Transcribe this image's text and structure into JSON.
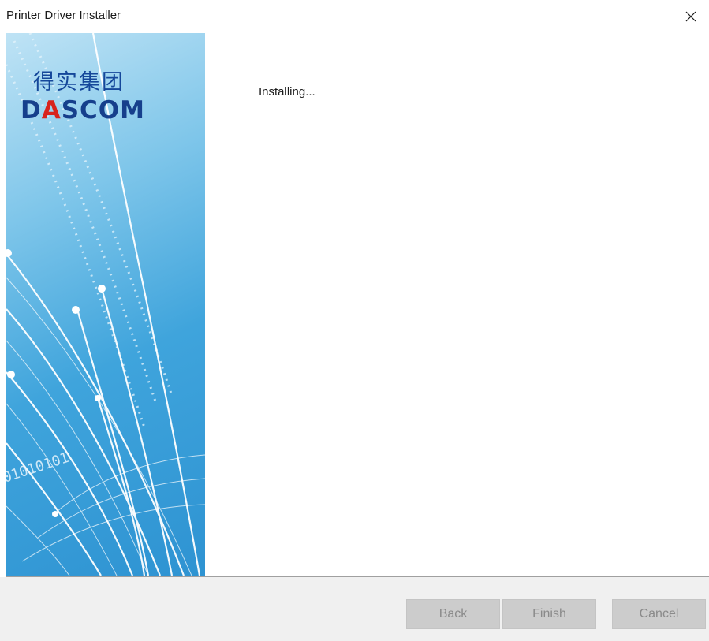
{
  "window": {
    "title": "Printer Driver Installer"
  },
  "banner": {
    "logo_cn": "得实集团",
    "logo_en_prefix": "D",
    "logo_en_accent": "A",
    "logo_en_suffix": "SCOM"
  },
  "content": {
    "status": "Installing..."
  },
  "footer": {
    "back_label": "Back",
    "finish_label": "Finish",
    "cancel_label": "Cancel"
  },
  "colors": {
    "brand_blue": "#15479a",
    "brand_red": "#d8231d",
    "disabled_button": "#cccccc",
    "footer_bg": "#f0f0f0"
  }
}
